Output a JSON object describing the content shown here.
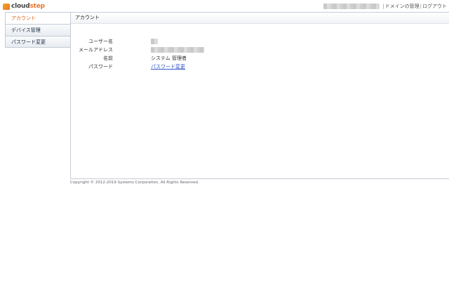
{
  "app": {
    "logo_cloud": "cloud",
    "logo_step": "step"
  },
  "header": {
    "user_label": "",
    "domain_link": "ドメインの管理",
    "logout_link": "ログアウト",
    "separator": "|"
  },
  "sidebar": {
    "items": [
      {
        "label": "アカウント",
        "active": true
      },
      {
        "label": "デバイス管理",
        "active": false
      },
      {
        "label": "パスワード変更",
        "active": false
      }
    ]
  },
  "main": {
    "title": "アカウント",
    "fields": [
      {
        "label": "ユーザー名",
        "value": ""
      },
      {
        "label": "メールアドレス",
        "value": ""
      },
      {
        "label": "名前",
        "value": "システム 管理者"
      },
      {
        "label": "パスワード",
        "value": "パスワード変更"
      }
    ]
  },
  "footer": {
    "copyright": "Copyright © 2012-2019 Systems Corporation, All Rights Reserved."
  },
  "colors": {
    "accent": "#e06010",
    "link": "#3355cc",
    "border": "#c5ccd6"
  }
}
